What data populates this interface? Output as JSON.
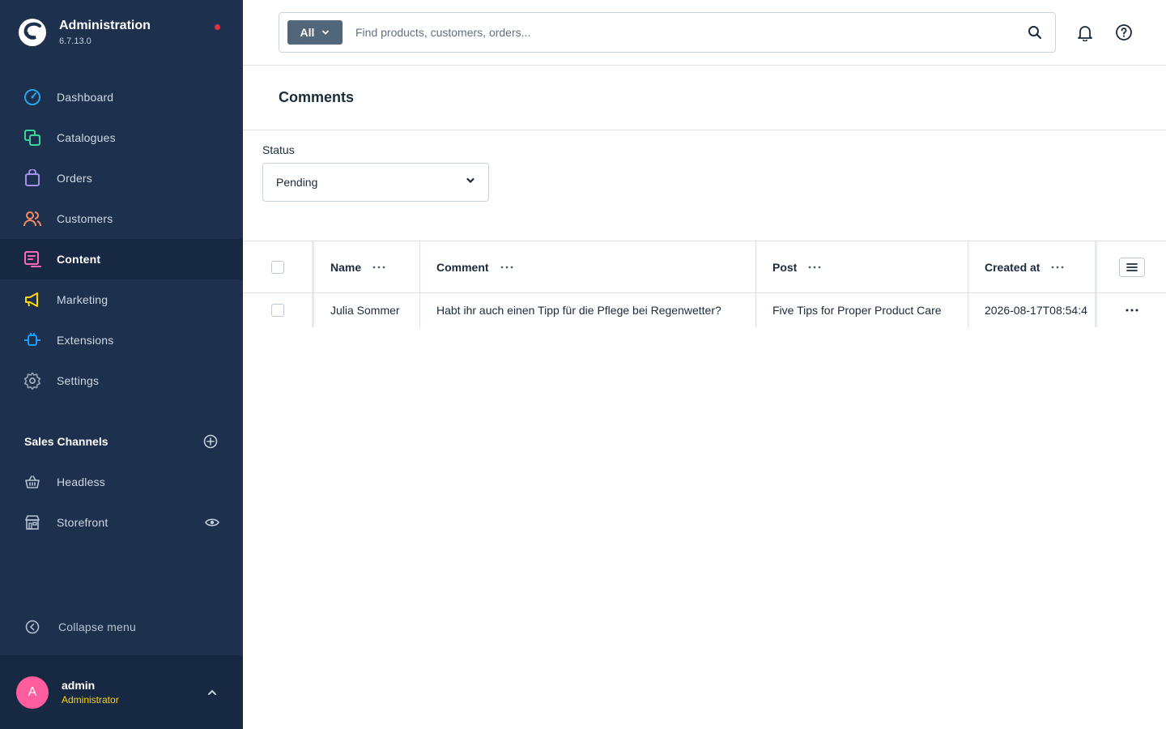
{
  "brand": {
    "title": "Administration",
    "version": "6.7.13.0"
  },
  "nav": [
    {
      "label": "Dashboard",
      "icon": "dashboard-icon",
      "color": "#26a6e8"
    },
    {
      "label": "Catalogues",
      "icon": "catalogues-icon",
      "color": "#37d69a"
    },
    {
      "label": "Orders",
      "icon": "orders-icon",
      "color": "#a092f0"
    },
    {
      "label": "Customers",
      "icon": "customers-icon",
      "color": "#f88962"
    },
    {
      "label": "Content",
      "icon": "content-icon",
      "color": "#ff68b4",
      "active": true
    },
    {
      "label": "Marketing",
      "icon": "marketing-icon",
      "color": "#ffd700"
    },
    {
      "label": "Extensions",
      "icon": "extensions-icon",
      "color": "#189eff"
    },
    {
      "label": "Settings",
      "icon": "settings-icon",
      "color": "#9aa8b5"
    }
  ],
  "sales_channels": {
    "title": "Sales Channels",
    "items": [
      {
        "label": "Headless",
        "icon": "basket-icon"
      },
      {
        "label": "Storefront",
        "icon": "storefront-icon",
        "has_eye": true
      }
    ]
  },
  "collapse_label": "Collapse menu",
  "user": {
    "initial": "A",
    "name": "admin",
    "role": "Administrator"
  },
  "search": {
    "type_label": "All",
    "placeholder": "Find products, customers, orders..."
  },
  "page": {
    "title": "Comments"
  },
  "filter": {
    "label": "Status",
    "value": "Pending"
  },
  "grid": {
    "columns": {
      "name": "Name",
      "comment": "Comment",
      "post": "Post",
      "created": "Created at"
    },
    "rows": [
      {
        "name": "Julia Sommer",
        "comment": "Habt ihr auch einen Tipp für die Pflege bei Regenwetter?",
        "post": "Five Tips for Proper Product Care",
        "created": "2026-08-17T08:54:4"
      }
    ]
  },
  "colors": {
    "sidebar": "#1d304e",
    "sidebar_dark": "#172842",
    "accent_pink": "#ff5d9d",
    "role_yellow": "#ffd400",
    "notify_red": "#e52e3e"
  }
}
